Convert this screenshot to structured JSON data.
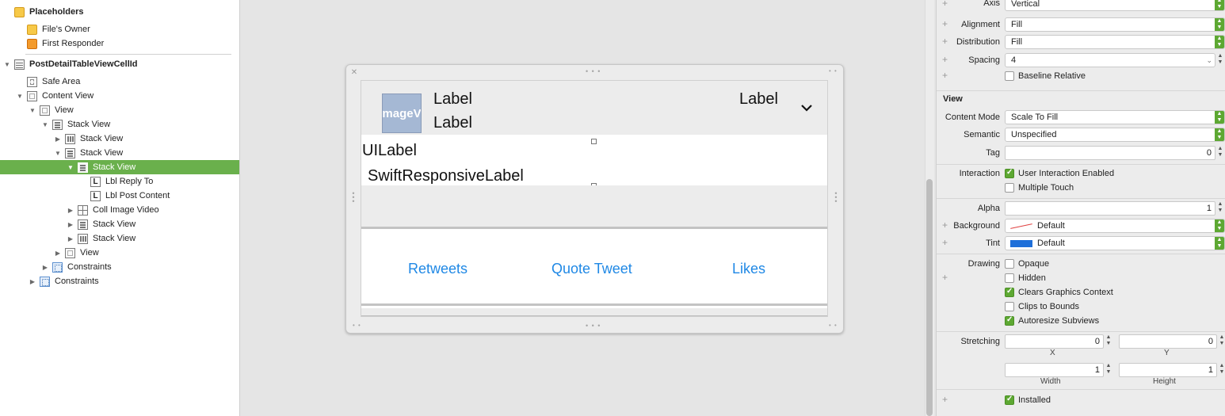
{
  "outline": {
    "items": [
      {
        "label": "Placeholders",
        "icon": "placeholder-cube-icon",
        "bold": true
      },
      {
        "label": "File's Owner",
        "icon": "files-owner-icon"
      },
      {
        "label": "First Responder",
        "icon": "first-responder-icon"
      },
      {
        "label": "PostDetailTableViewCellId",
        "icon": "table-cell-icon",
        "bold": true
      },
      {
        "label": "Safe Area",
        "icon": "safe-area-icon"
      },
      {
        "label": "Content View",
        "icon": "view-icon"
      },
      {
        "label": "View",
        "icon": "view-icon"
      },
      {
        "label": "Stack View",
        "icon": "vertical-stack-icon"
      },
      {
        "label": "Stack View",
        "icon": "horizontal-stack-icon"
      },
      {
        "label": "Stack View",
        "icon": "vertical-stack-icon"
      },
      {
        "label": "Stack View",
        "icon": "vertical-stack-icon",
        "selected": true
      },
      {
        "label": "Lbl Reply To",
        "icon": "label-icon"
      },
      {
        "label": "Lbl Post Content",
        "icon": "label-icon"
      },
      {
        "label": "Coll Image Video",
        "icon": "collection-view-icon"
      },
      {
        "label": "Stack View",
        "icon": "vertical-stack-icon"
      },
      {
        "label": "Stack View",
        "icon": "horizontal-stack-icon"
      },
      {
        "label": "View",
        "icon": "view-icon"
      },
      {
        "label": "Constraints",
        "icon": "constraints-icon"
      },
      {
        "label": "Constraints",
        "icon": "constraints-icon"
      }
    ]
  },
  "canvas": {
    "image_view_text": "mageV",
    "label_top_left": "Label",
    "label_bottom_left": "Label",
    "label_right": "Label",
    "chevron": "⌄",
    "uilabel": "UILabel",
    "swift_label": "SwiftResponsiveLabel",
    "actions": [
      "Retweets",
      "Quote Tweet",
      "Likes"
    ],
    "grip": "• • •",
    "close": "✕"
  },
  "inspector": {
    "axis": {
      "label": "Axis",
      "value": "Vertical"
    },
    "alignment": {
      "label": "Alignment",
      "value": "Fill"
    },
    "distribution": {
      "label": "Distribution",
      "value": "Fill"
    },
    "spacing": {
      "label": "Spacing",
      "value": "4"
    },
    "baseline_relative": {
      "label": "Baseline Relative",
      "checked": false
    },
    "view_section": "View",
    "content_mode": {
      "label": "Content Mode",
      "value": "Scale To Fill"
    },
    "semantic": {
      "label": "Semantic",
      "value": "Unspecified"
    },
    "tag": {
      "label": "Tag",
      "value": "0"
    },
    "interaction": {
      "label": "Interaction",
      "options": [
        {
          "label": "User Interaction Enabled",
          "checked": true
        },
        {
          "label": "Multiple Touch",
          "checked": false
        }
      ]
    },
    "alpha": {
      "label": "Alpha",
      "value": "1"
    },
    "background": {
      "label": "Background",
      "value": "Default"
    },
    "tint": {
      "label": "Tint",
      "value": "Default",
      "color": "#1e6fd9"
    },
    "drawing": {
      "label": "Drawing",
      "options": [
        {
          "label": "Opaque",
          "checked": false
        },
        {
          "label": "Hidden",
          "checked": false
        },
        {
          "label": "Clears Graphics Context",
          "checked": true
        },
        {
          "label": "Clips to Bounds",
          "checked": false
        },
        {
          "label": "Autoresize Subviews",
          "checked": true
        }
      ]
    },
    "stretching": {
      "label": "Stretching",
      "x": "0",
      "y": "0",
      "width": "1",
      "height": "1",
      "x_label": "X",
      "y_label": "Y",
      "width_label": "Width",
      "height_label": "Height"
    },
    "installed": {
      "label": "Installed",
      "checked": true
    }
  },
  "colors": {
    "selection": "#6ab04c",
    "accent_green": "#5da832",
    "ios_blue": "#1f88e5"
  }
}
